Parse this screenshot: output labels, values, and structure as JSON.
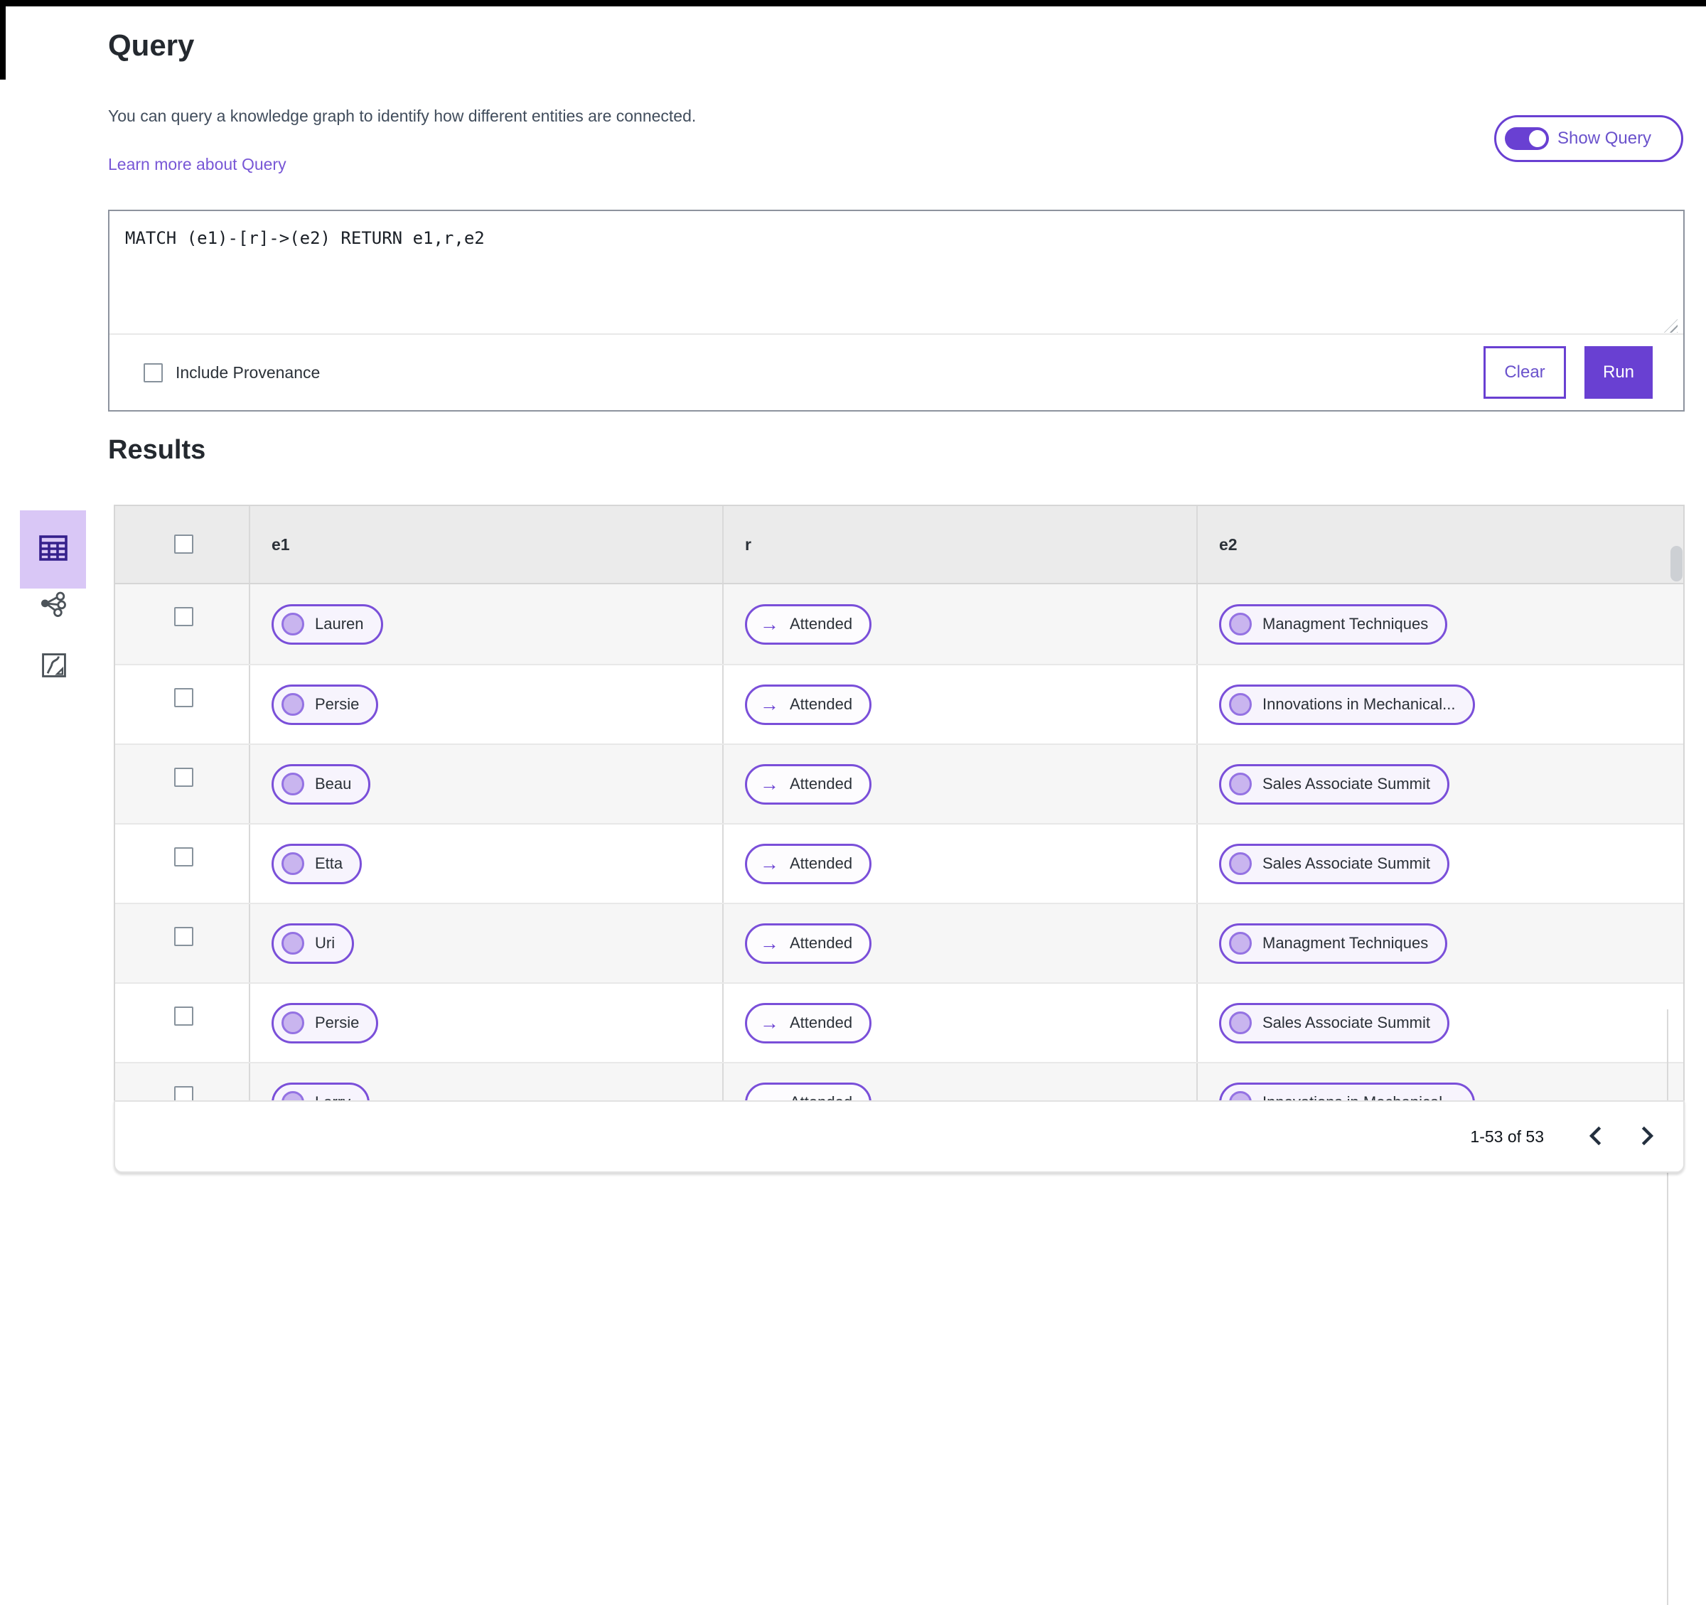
{
  "colors": {
    "primary_purple": "#6940d2",
    "link_purple": "#7857d6",
    "pill_border": "#7a4fd9",
    "pill_background": "#f7f4fd",
    "entity_dot_fill": "#c9b5ef",
    "entity_dot_border": "#9472e3",
    "selected_view_tile_background": "#d9c7f6",
    "table_header_background": "#ebebeb",
    "row_stripe_background": "#f6f6f6"
  },
  "header": {
    "title": "Query",
    "description": "You can query a knowledge graph to identify how different entities are connected.",
    "learn_more_link": "Learn more about Query",
    "show_query_label": "Show Query",
    "show_query_state": "on"
  },
  "query_editor": {
    "query_text": "MATCH (e1)-[r]->(e2) RETURN e1,r,e2",
    "include_provenance_label": "Include Provenance",
    "include_provenance_checked": false,
    "clear_button_label": "Clear",
    "run_button_label": "Run"
  },
  "results": {
    "heading": "Results",
    "view_icons": [
      "table-view",
      "graph-view",
      "freeform-view"
    ],
    "selected_view": "table-view",
    "table": {
      "columns": [
        "e1",
        "r",
        "e2"
      ],
      "relationship_arrow": "→",
      "rows": [
        {
          "e1": "Lauren",
          "r": "Attended",
          "e2": "Managment Techniques"
        },
        {
          "e1": "Persie",
          "r": "Attended",
          "e2": "Innovations in Mechanical..."
        },
        {
          "e1": "Beau",
          "r": "Attended",
          "e2": "Sales Associate Summit"
        },
        {
          "e1": "Etta",
          "r": "Attended",
          "e2": "Sales Associate Summit"
        },
        {
          "e1": "Uri",
          "r": "Attended",
          "e2": "Managment Techniques"
        },
        {
          "e1": "Persie",
          "r": "Attended",
          "e2": "Sales Associate Summit"
        },
        {
          "e1": "Larry",
          "r": "Attended",
          "e2": "Innovations in Mechanical..."
        }
      ]
    },
    "pagination": {
      "range_label": "1-53 of 53"
    }
  }
}
